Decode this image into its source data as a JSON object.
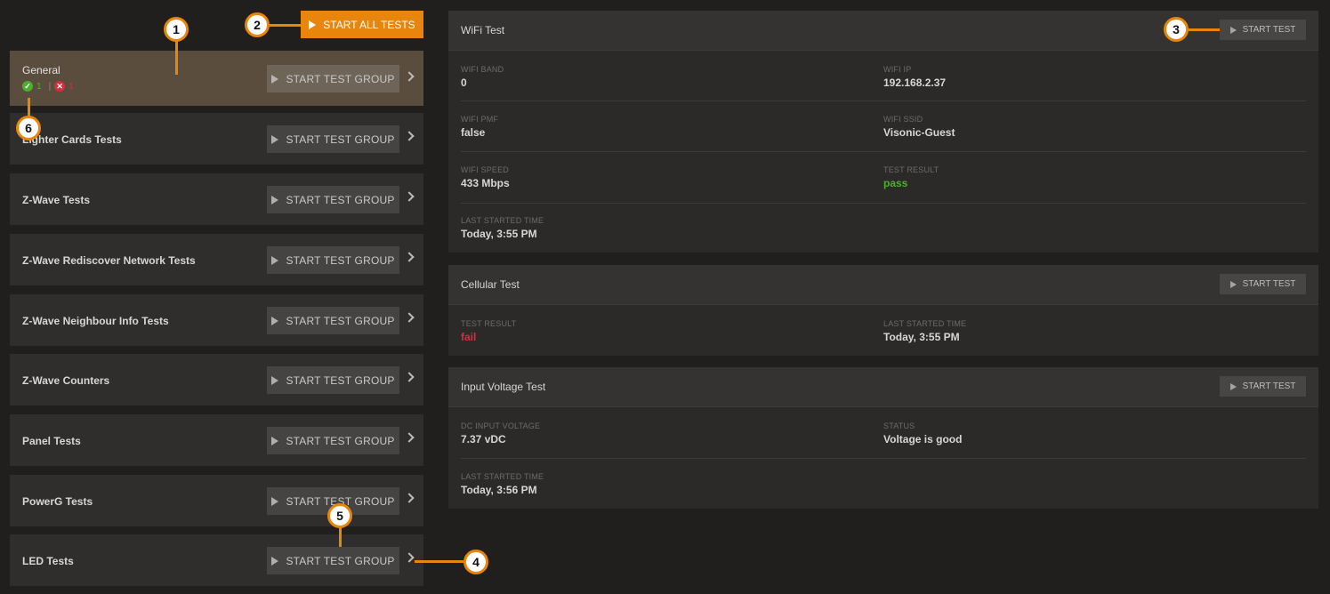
{
  "toolbar": {
    "start_all_label": "START ALL TESTS"
  },
  "groups": [
    {
      "name": "General",
      "button": "START TEST GROUP",
      "passed": "1",
      "failed": "1",
      "separator": "|"
    },
    {
      "name": "Lighter Cards Tests",
      "button": "START TEST GROUP"
    },
    {
      "name": "Z-Wave Tests",
      "button": "START TEST GROUP"
    },
    {
      "name": "Z-Wave Rediscover Network Tests",
      "button": "START TEST GROUP"
    },
    {
      "name": "Z-Wave Neighbour Info Tests",
      "button": "START TEST GROUP"
    },
    {
      "name": "Z-Wave Counters",
      "button": "START TEST GROUP"
    },
    {
      "name": "Panel Tests",
      "button": "START TEST GROUP"
    },
    {
      "name": "PowerG Tests",
      "button": "START TEST GROUP"
    },
    {
      "name": "LED Tests",
      "button": "START TEST GROUP"
    }
  ],
  "tests": {
    "wifi": {
      "title": "WiFi Test",
      "button": "START TEST",
      "fields": [
        {
          "label": "WIFI BAND",
          "value": "0"
        },
        {
          "label": "WIFI IP",
          "value": "192.168.2.37"
        },
        {
          "label": "WIFI PMF",
          "value": "false"
        },
        {
          "label": "WIFI SSID",
          "value": "Visonic-Guest"
        },
        {
          "label": "WIFI SPEED",
          "value": "433 Mbps"
        },
        {
          "label": "TEST RESULT",
          "value": "pass"
        },
        {
          "label": "LAST STARTED TIME",
          "value": "Today, 3:55 PM"
        }
      ]
    },
    "cellular": {
      "title": "Cellular Test",
      "button": "START TEST",
      "fields": [
        {
          "label": "TEST RESULT",
          "value": "fail"
        },
        {
          "label": "LAST STARTED TIME",
          "value": "Today, 3:55 PM"
        }
      ]
    },
    "voltage": {
      "title": "Input Voltage Test",
      "button": "START TEST",
      "fields": [
        {
          "label": "DC INPUT VOLTAGE",
          "value": "7.37 vDC"
        },
        {
          "label": "STATUS",
          "value": "Voltage is good"
        },
        {
          "label": "LAST STARTED TIME",
          "value": "Today, 3:56 PM"
        }
      ]
    }
  },
  "callouts": [
    "1",
    "2",
    "3",
    "4",
    "5",
    "6"
  ],
  "colors": {
    "accent": "#e8850c",
    "pass": "#4cae31",
    "fail": "#d2303e"
  }
}
